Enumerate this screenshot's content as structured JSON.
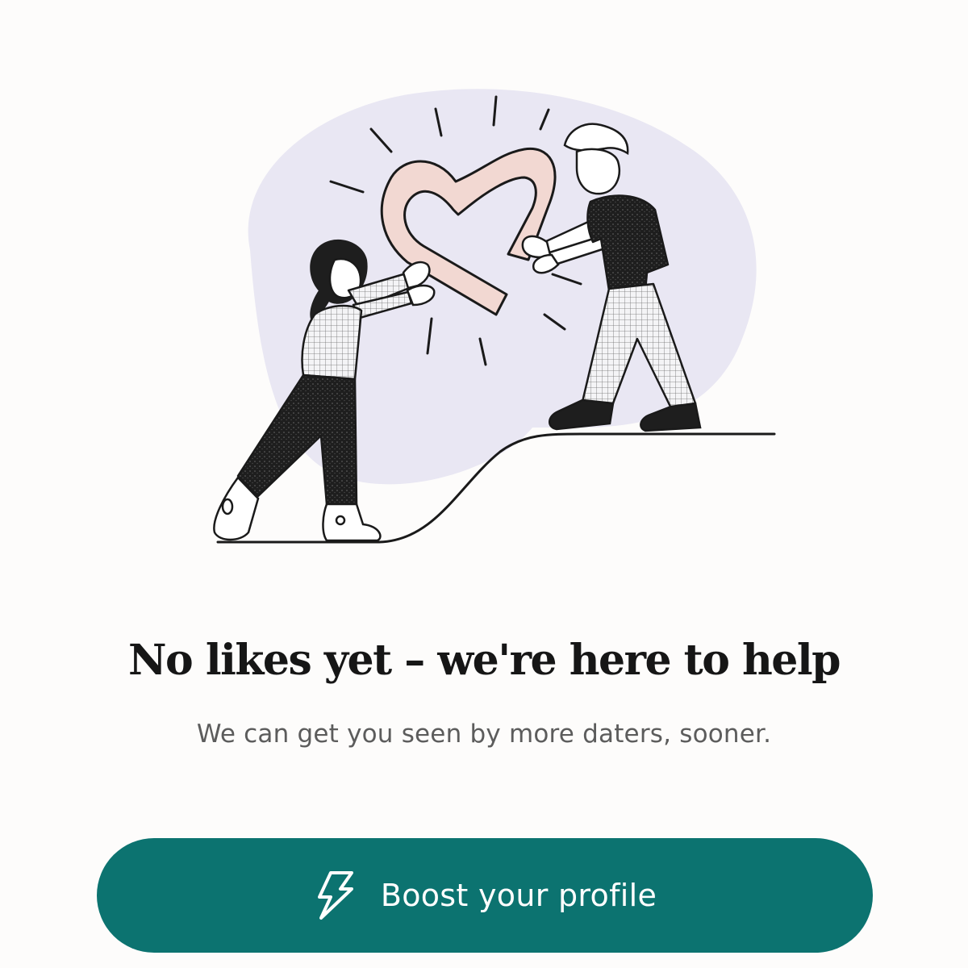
{
  "empty_state": {
    "illustration_icon": "two-people-holding-heart-illustration",
    "title": "No likes yet – we're here to help",
    "subtitle": "We can get you seen by more daters, sooner."
  },
  "boost_button": {
    "label": "Boost your profile",
    "icon": "lightning-bolt-icon"
  },
  "colors": {
    "background": "#fdfcfb",
    "accent": "#0c7370",
    "heart": "#f2d8d2",
    "halo": "#e9e7f3"
  }
}
